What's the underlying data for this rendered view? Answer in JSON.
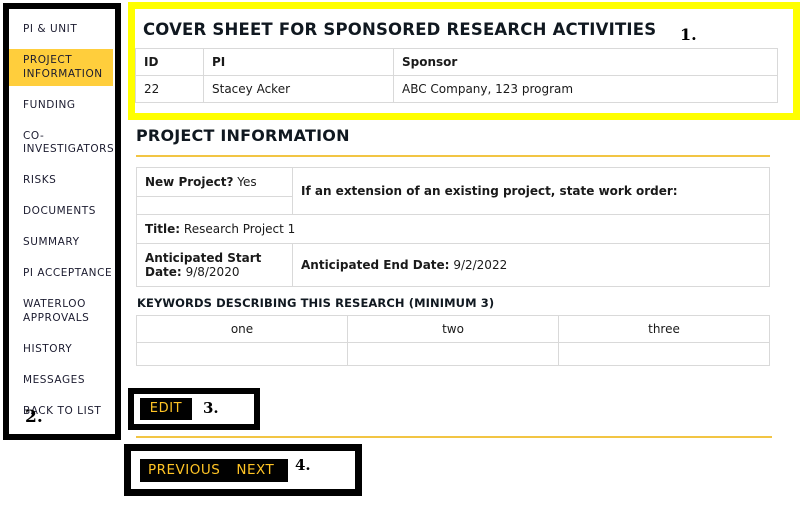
{
  "sidebar": {
    "items": [
      {
        "label": "PI & UNIT",
        "active": false
      },
      {
        "label": "PROJECT INFORMATION",
        "active": true
      },
      {
        "label": "FUNDING",
        "active": false
      },
      {
        "label": "CO-INVESTIGATORS",
        "active": false
      },
      {
        "label": "RISKS",
        "active": false
      },
      {
        "label": "DOCUMENTS",
        "active": false
      },
      {
        "label": "SUMMARY",
        "active": false
      },
      {
        "label": "PI ACCEPTANCE",
        "active": false
      },
      {
        "label": "WATERLOO APPROVALS",
        "active": false
      },
      {
        "label": "HISTORY",
        "active": false
      },
      {
        "label": "MESSAGES",
        "active": false
      },
      {
        "label": "BACK TO LIST",
        "active": false
      }
    ],
    "annotation_number": "2.",
    "active_highlight_color": "#FFCE3C"
  },
  "cover_sheet": {
    "title": "COVER SHEET FOR SPONSORED RESEARCH ACTIVITIES",
    "annotation_number": "1.",
    "annotation_border_color": "#FFFF00",
    "columns": [
      "ID",
      "PI",
      "Sponsor"
    ],
    "rows": [
      [
        "22",
        "Stacey Acker",
        "ABC Company, 123 program"
      ]
    ]
  },
  "project_information": {
    "heading": "PROJECT INFORMATION",
    "rule_color": "#F2C544",
    "new_project_label": "New Project?",
    "new_project_value": "Yes",
    "extension_label": "If an extension of an existing project, state work order:",
    "extension_value": "",
    "title_label": "Title:",
    "title_value": "Research Project 1",
    "start_date_label": "Anticipated Start Date:",
    "start_date_value": "9/8/2020",
    "end_date_label": "Anticipated End Date:",
    "end_date_value": "9/2/2022",
    "keywords_heading": "KEYWORDS DESCRIBING THIS RESEARCH (MINIMUM 3)",
    "keywords": [
      "one",
      "two",
      "three"
    ],
    "keywords_empty_row": [
      "",
      "",
      ""
    ]
  },
  "actions": {
    "edit_label": "EDIT",
    "edit_annotation_number": "3.",
    "previous_label": "PREVIOUS",
    "next_label": "NEXT",
    "pager_annotation_number": "4.",
    "button_bg": "#010101",
    "button_text_color": "#FFC425"
  }
}
